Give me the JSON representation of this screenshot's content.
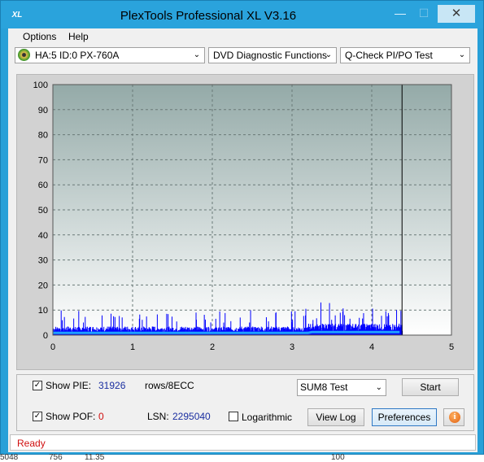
{
  "window": {
    "app_icon_text": "XL",
    "title": "PlexTools Professional XL V3.16",
    "minimize_glyph": "—",
    "maximize_glyph": "☐",
    "close_glyph": "✕"
  },
  "menu": {
    "options": "Options",
    "help": "Help"
  },
  "toolbar": {
    "drive": "HA:5 ID:0  PX-760A",
    "function": "DVD Diagnostic Functions",
    "test": "Q-Check PI/PO Test",
    "arrow": "⌄"
  },
  "chart_data": {
    "type": "bar",
    "y_ticks": [
      "100",
      "90",
      "80",
      "70",
      "60",
      "50",
      "40",
      "30",
      "20",
      "10",
      "0"
    ],
    "x_ticks": [
      "0",
      "1",
      "2",
      "3",
      "4",
      "5"
    ],
    "xlim": [
      0,
      5
    ],
    "ylim": [
      0,
      100
    ],
    "end_marker_x": 4.38,
    "grid": true,
    "pie_bar_color": "#0000ff",
    "pi8_line_color": "#1ea0ff",
    "segments": [
      {
        "from": 0.0,
        "to": 0.5,
        "base": 3,
        "peak": 8
      },
      {
        "from": 0.5,
        "to": 1.5,
        "base": 3,
        "peak": 7
      },
      {
        "from": 1.5,
        "to": 2.5,
        "base": 3,
        "peak": 8
      },
      {
        "from": 2.5,
        "to": 3.2,
        "base": 3,
        "peak": 9
      },
      {
        "from": 3.2,
        "to": 3.7,
        "base": 4,
        "peak": 12
      },
      {
        "from": 3.7,
        "to": 4.38,
        "base": 4,
        "peak": 10
      }
    ]
  },
  "panel": {
    "show_pie_label": "Show PIE:",
    "pie_value": "31926",
    "pie_units": "rows/8ECC",
    "show_poe_label": "Show POF:",
    "poe_value": "0",
    "lsn_label": "LSN:",
    "lsn_value": "2295040",
    "log_label": "Logarithmic",
    "sum_select": "SUM8 Test",
    "start": "Start",
    "view_log": "View Log",
    "preferences": "Preferences",
    "check": "✓",
    "info": "i"
  },
  "status": {
    "text": "Ready"
  },
  "background_window": {
    "a": "5048",
    "b": "756",
    "c": "11.35",
    "d": "100"
  }
}
